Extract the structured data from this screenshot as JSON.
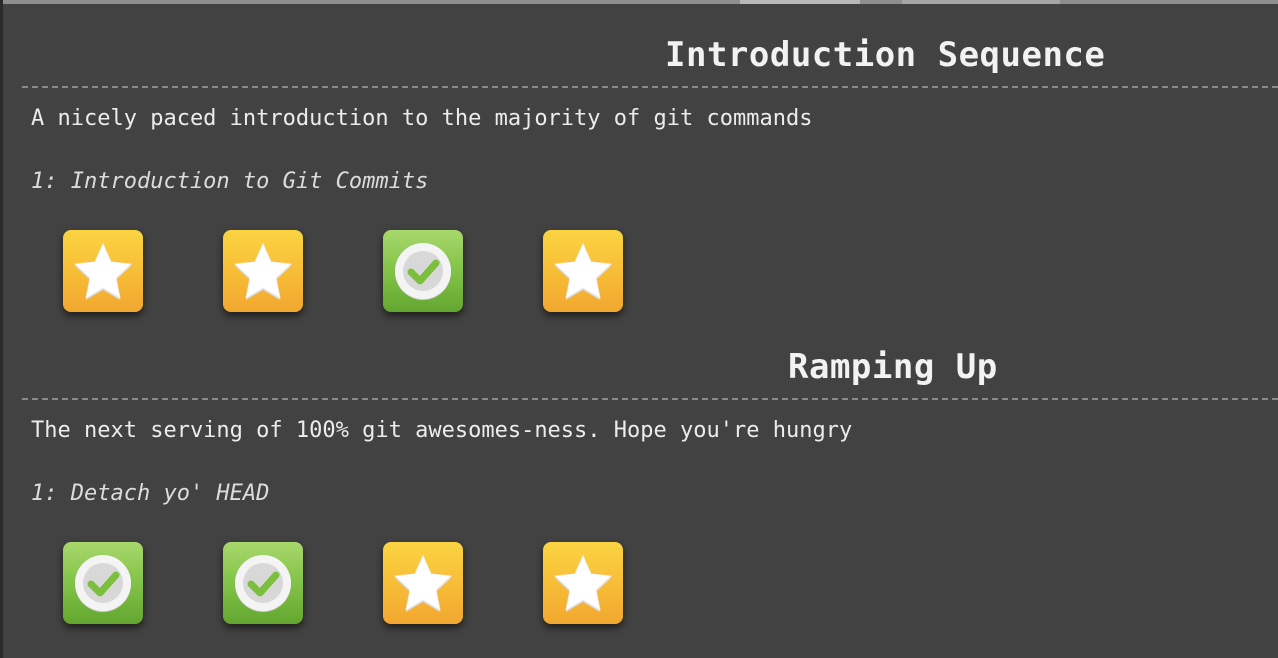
{
  "colors": {
    "background": "#424242",
    "star_badge": "#f8c038",
    "done_badge": "#86c54a"
  },
  "sections": [
    {
      "title": "Introduction Sequence",
      "description": "A nicely paced introduction to the majority of git commands",
      "level_name": "1: Introduction to Git Commits",
      "levels": [
        {
          "status": "incomplete",
          "icon": "star-icon"
        },
        {
          "status": "incomplete",
          "icon": "star-icon"
        },
        {
          "status": "complete",
          "icon": "checkmark-icon"
        },
        {
          "status": "incomplete",
          "icon": "star-icon"
        }
      ]
    },
    {
      "title": "Ramping Up",
      "description": "The next serving of 100% git awesomes-ness. Hope you're hungry",
      "level_name": "1: Detach yo' HEAD",
      "levels": [
        {
          "status": "complete",
          "icon": "checkmark-icon"
        },
        {
          "status": "complete",
          "icon": "checkmark-icon"
        },
        {
          "status": "incomplete",
          "icon": "star-icon"
        },
        {
          "status": "incomplete",
          "icon": "star-icon"
        }
      ]
    }
  ]
}
